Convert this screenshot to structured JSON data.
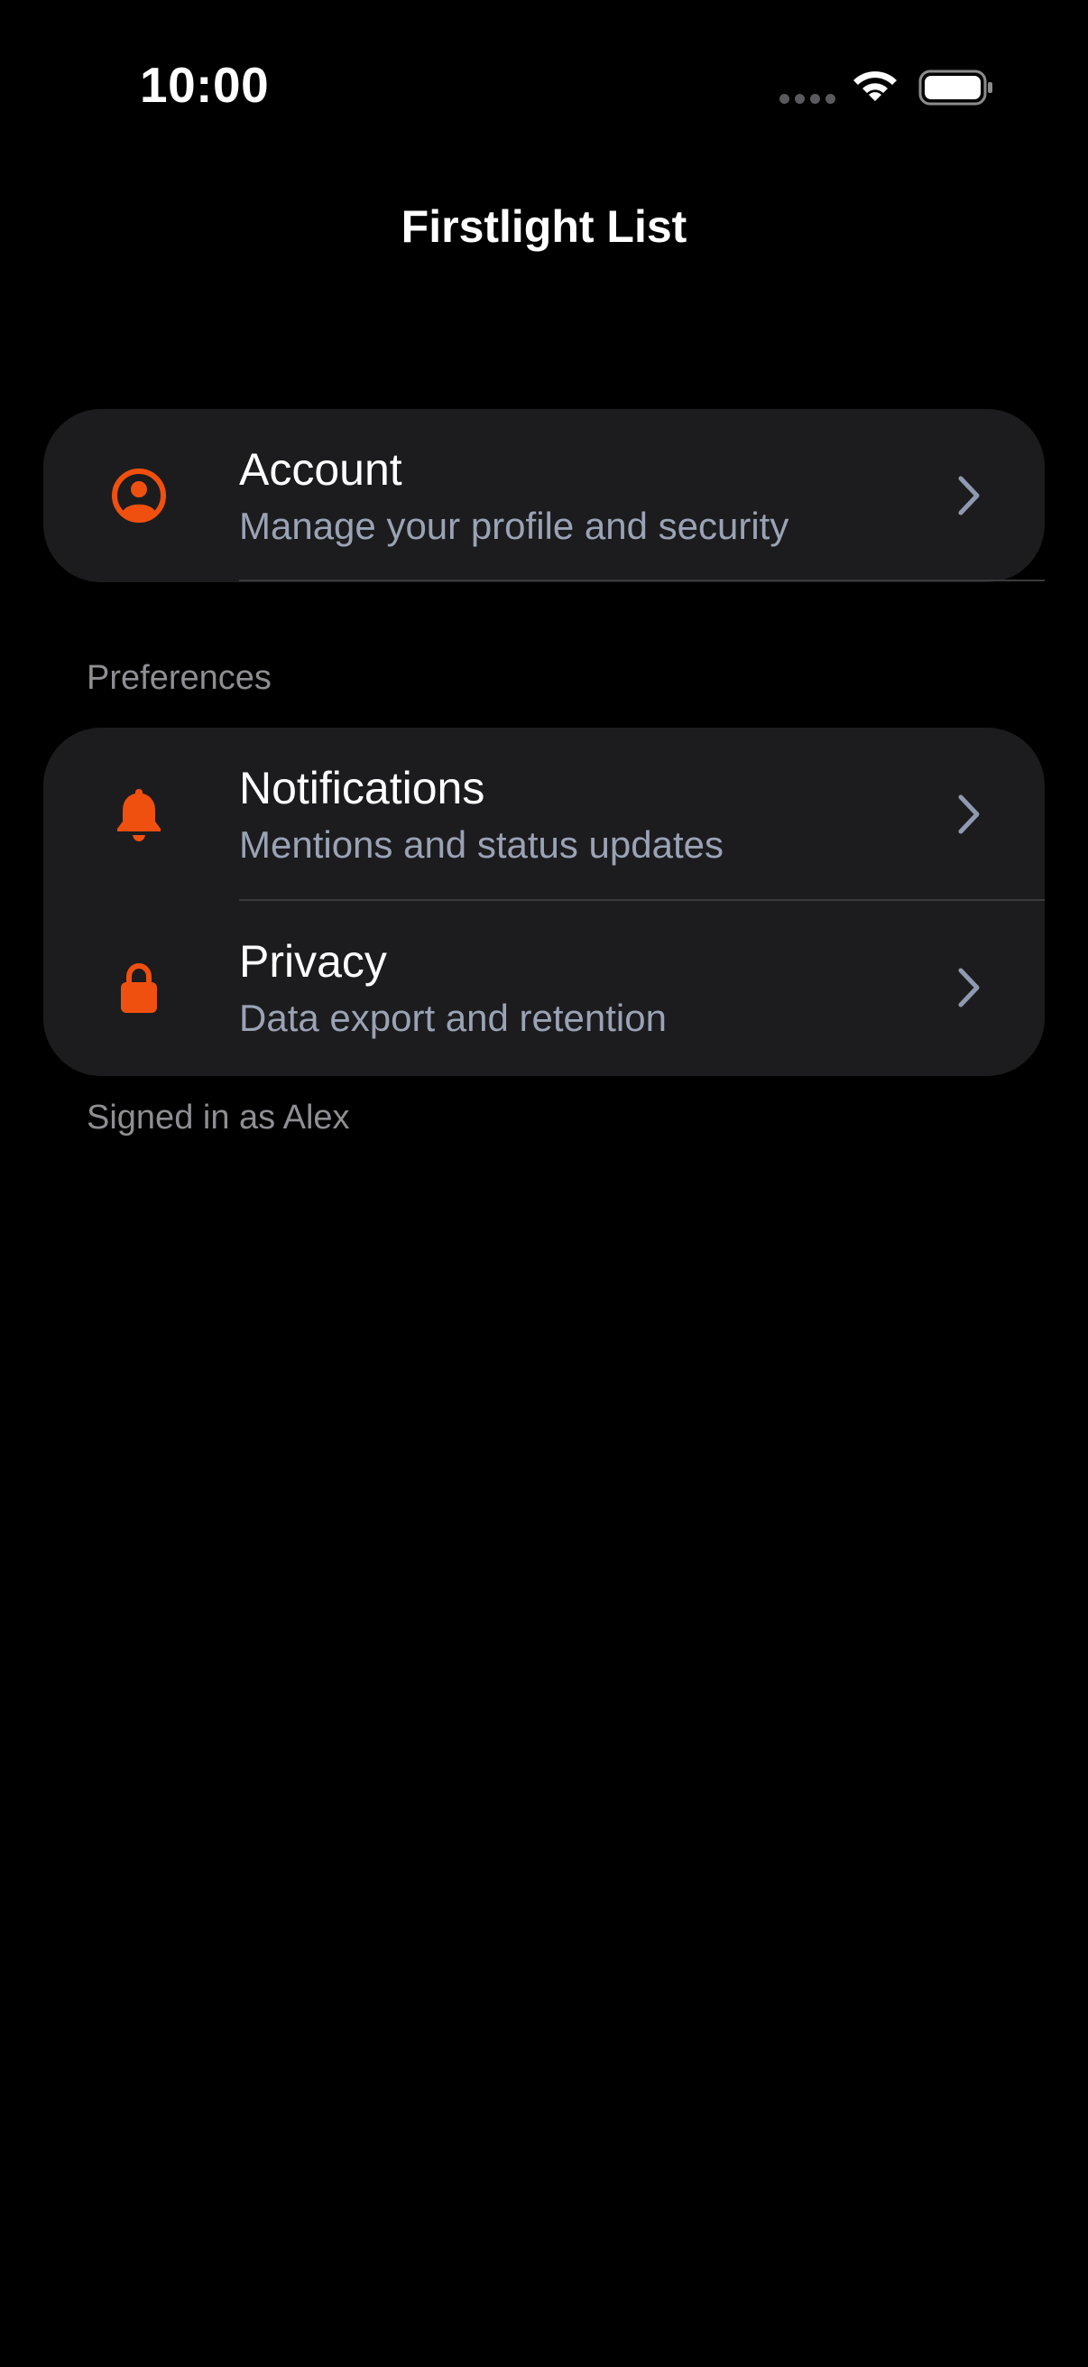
{
  "status_bar": {
    "time": "10:00"
  },
  "nav": {
    "title": "Firstlight List"
  },
  "account": {
    "icon": "person-circle-icon",
    "title": "Account",
    "subtitle": "Manage your profile and security"
  },
  "preferences": {
    "header": "Preferences",
    "items": [
      {
        "icon": "bell-icon",
        "title": "Notifications",
        "subtitle": "Mentions and status updates"
      },
      {
        "icon": "lock-icon",
        "title": "Privacy",
        "subtitle": "Data export and retention"
      }
    ],
    "footer": "Signed in as Alex"
  },
  "colors": {
    "background": "#000000",
    "card": "#1c1c1e",
    "accent": "#f0500f",
    "subtitle": "#9aa3b5",
    "section_text": "#8e8e93",
    "chevron": "#8f9ab0"
  }
}
